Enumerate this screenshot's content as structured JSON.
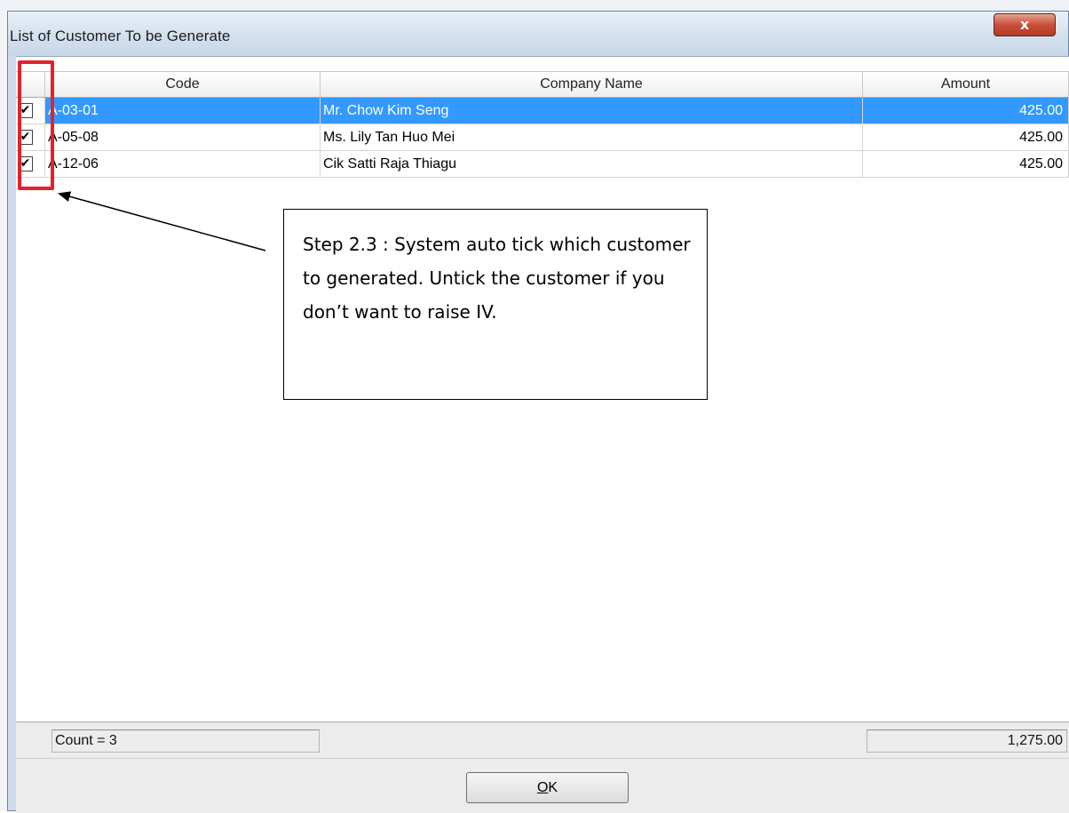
{
  "window": {
    "title": "List of Customer To be Generate",
    "close_glyph": "x"
  },
  "grid": {
    "columns": [
      "",
      "Code",
      "Company Name",
      "Amount"
    ],
    "rows": [
      {
        "checked": true,
        "code": "A-03-01",
        "name": "Mr. Chow Kim Seng",
        "amount": "425.00",
        "selected": true
      },
      {
        "checked": true,
        "code": "A-05-08",
        "name": "Ms. Lily Tan Huo Mei",
        "amount": "425.00",
        "selected": false
      },
      {
        "checked": true,
        "code": "A-12-06",
        "name": "Cik Satti Raja Thiagu",
        "amount": "425.00",
        "selected": false
      }
    ]
  },
  "summary": {
    "count": "Count = 3",
    "total": "1,275.00"
  },
  "ok_button": {
    "mnemonic": "O",
    "rest": "K"
  },
  "annotation": {
    "text": "Step 2.3 : System auto tick which customer to generated. Untick the customer if you don’t want to raise IV."
  },
  "colors": {
    "selection": "#3399ff",
    "annotation_red": "#e3222b"
  },
  "icons": {
    "check": "✔"
  }
}
